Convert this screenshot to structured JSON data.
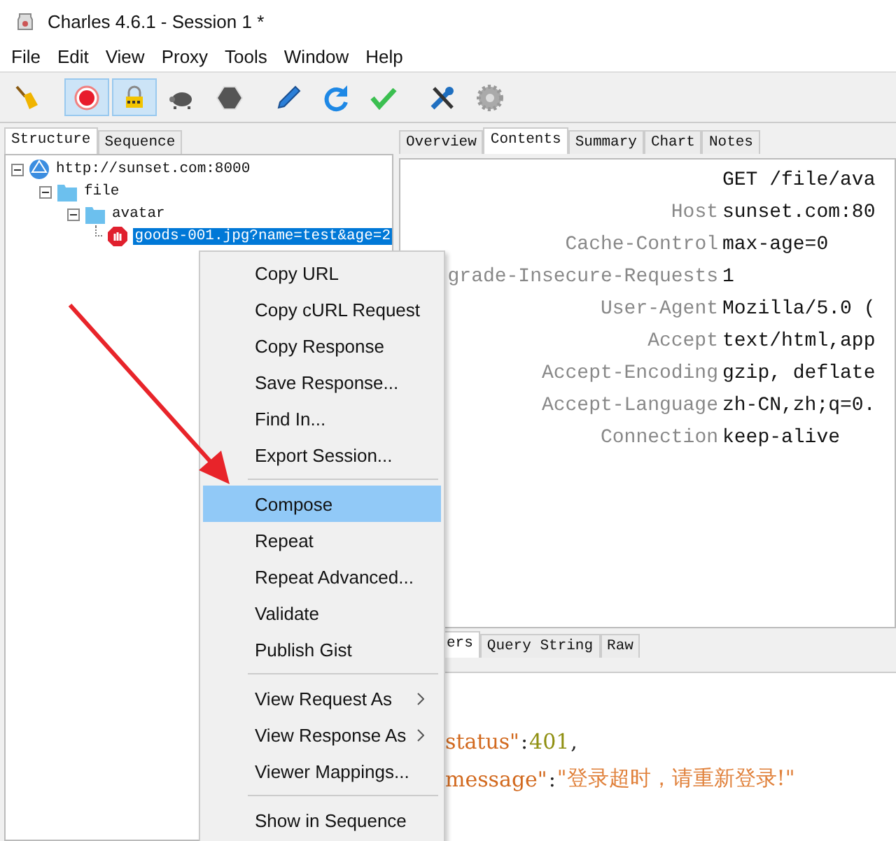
{
  "window": {
    "title": "Charles 4.6.1 - Session 1 *"
  },
  "menu_bar": [
    "File",
    "Edit",
    "View",
    "Proxy",
    "Tools",
    "Window",
    "Help"
  ],
  "toolbar": [
    [
      {
        "kind": "broom",
        "on": false
      }
    ],
    [
      {
        "kind": "record",
        "on": true
      },
      {
        "kind": "ssl",
        "on": true
      },
      {
        "kind": "throttle",
        "on": false
      },
      {
        "kind": "stop",
        "on": false
      }
    ],
    [
      {
        "kind": "compose"
      },
      {
        "kind": "repeat"
      },
      {
        "kind": "validate"
      }
    ],
    [
      {
        "kind": "tools"
      },
      {
        "kind": "settings"
      }
    ]
  ],
  "structure_tabs": [
    {
      "label": "Structure",
      "selected": true
    },
    {
      "label": "Sequence",
      "selected": false
    }
  ],
  "tree": [
    {
      "kind": "host",
      "label": "http://sunset.com:8000",
      "expanded": true,
      "selected": false,
      "children": [
        {
          "kind": "folder",
          "label": "file",
          "expanded": true,
          "selected": false,
          "children": [
            {
              "kind": "folder",
              "label": "avatar",
              "expanded": true,
              "selected": false,
              "children": [
                {
                  "kind": "request",
                  "label": "goods-001.jpg?name=test&age=2",
                  "selected": true
                }
              ]
            }
          ]
        }
      ]
    }
  ],
  "detail_tabs": [
    {
      "label": "Overview",
      "selected": false
    },
    {
      "label": "Contents",
      "selected": true
    },
    {
      "label": "Summary",
      "selected": false
    },
    {
      "label": "Chart",
      "selected": false
    },
    {
      "label": "Notes",
      "selected": false
    }
  ],
  "request_headers": [
    {
      "value": "GET /file/ava"
    },
    {
      "name": "Host",
      "value": "sunset.com:80"
    },
    {
      "name": "Cache-Control",
      "value": "max-age=0"
    },
    {
      "name": "grade-Insecure-Requests",
      "value": "1"
    },
    {
      "name": "User-Agent",
      "value": "Mozilla/5.0 ("
    },
    {
      "name": "Accept",
      "value": "text/html,app"
    },
    {
      "name": "Accept-Encoding",
      "value": "gzip, deflate"
    },
    {
      "name": "Accept-Language",
      "value": "zh-CN,zh;q=0."
    },
    {
      "name": "Connection",
      "value": "keep-alive"
    }
  ],
  "body_tabs": [
    {
      "label": "ers",
      "selected": true
    },
    {
      "label": "Query String",
      "selected": false
    },
    {
      "label": "Raw",
      "selected": false
    }
  ],
  "response_body": [
    [
      {
        "kind": "key",
        "text": "status\""
      },
      {
        "kind": "punct",
        "text": ": "
      },
      {
        "kind": "number",
        "text": "401"
      },
      {
        "kind": "punct",
        "text": ","
      }
    ],
    [
      {
        "kind": "key",
        "text": "message\""
      },
      {
        "kind": "punct",
        "text": ": "
      },
      {
        "kind": "string",
        "text": "\"登录超时，请重新登录!\""
      }
    ]
  ],
  "context_menu": [
    [
      {
        "label": "Copy URL",
        "selected": false,
        "submenu": false
      },
      {
        "label": "Copy cURL Request",
        "selected": false,
        "submenu": false
      },
      {
        "label": "Copy Response",
        "selected": false,
        "submenu": false
      },
      {
        "label": "Save Response...",
        "selected": false,
        "submenu": false
      },
      {
        "label": "Find In...",
        "selected": false,
        "submenu": false
      },
      {
        "label": "Export Session...",
        "selected": false,
        "submenu": false
      }
    ],
    [
      {
        "label": "Compose",
        "selected": true,
        "submenu": false
      },
      {
        "label": "Repeat",
        "selected": false,
        "submenu": false
      },
      {
        "label": "Repeat Advanced...",
        "selected": false,
        "submenu": false
      },
      {
        "label": "Validate",
        "selected": false,
        "submenu": false
      },
      {
        "label": "Publish Gist",
        "selected": false,
        "submenu": false
      }
    ],
    [
      {
        "label": "View Request As",
        "selected": false,
        "submenu": true
      },
      {
        "label": "View Response As",
        "selected": false,
        "submenu": true
      },
      {
        "label": "Viewer Mappings...",
        "selected": false,
        "submenu": false
      }
    ],
    [
      {
        "label": "Show in Sequence",
        "selected": false,
        "submenu": false
      }
    ]
  ]
}
